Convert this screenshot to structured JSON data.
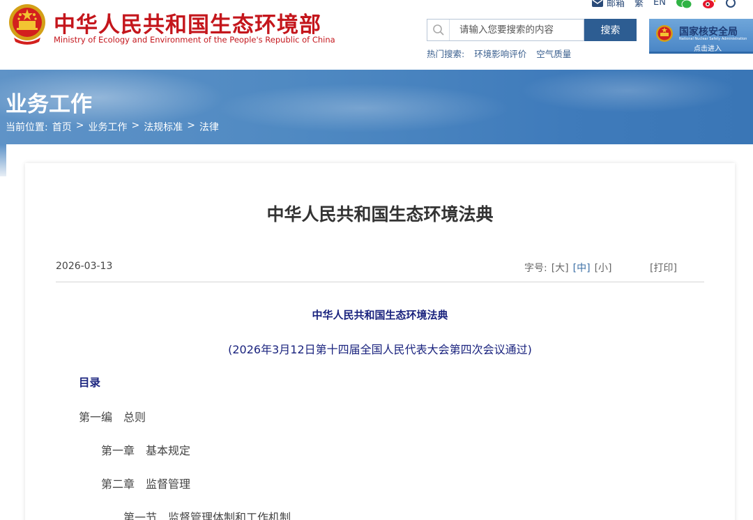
{
  "header": {
    "site_title_cn": "中华人民共和国生态环境部",
    "site_title_en": "Ministry of Ecology and Environment of the People's Republic of China",
    "top_links": {
      "mail": "邮箱",
      "traditional": "繁",
      "english": "EN"
    },
    "search": {
      "placeholder": "请输入您要搜索的内容",
      "button": "搜索"
    },
    "hot_search": {
      "label": "热门搜索:",
      "items": [
        "环境影响评价",
        "空气质量"
      ]
    },
    "nnsa": {
      "name_cn": "国家核安全局",
      "name_en": "National Nuclear Safety Administration",
      "enter": "点击进入"
    }
  },
  "banner": {
    "title": "业务工作",
    "breadcrumb_label": "当前位置:",
    "breadcrumb": [
      "首页",
      "业务工作",
      "法规标准",
      "法律"
    ],
    "separator": ">"
  },
  "article": {
    "title": "中华人民共和国生态环境法典",
    "date": "2026-03-13",
    "font_size_label": "字号:",
    "font_sizes": [
      "[大]",
      "[中]",
      "[小]"
    ],
    "print": "[打印]",
    "body_title": "中华人民共和国生态环境法典",
    "body_subtitle": "(2026年3月12日第十四届全国人民代表大会第四次会议通过)",
    "toc_heading": "目录",
    "toc": [
      "第一编　总则",
      "第一章　基本规定",
      "第二章　监督管理",
      "第一节　监督管理体制和工作机制"
    ]
  },
  "colors": {
    "brand_red": "#c4161c",
    "nav_blue": "#2d5d92",
    "body_navy": "#1a237e",
    "banner_blue": "#4f89c2"
  }
}
